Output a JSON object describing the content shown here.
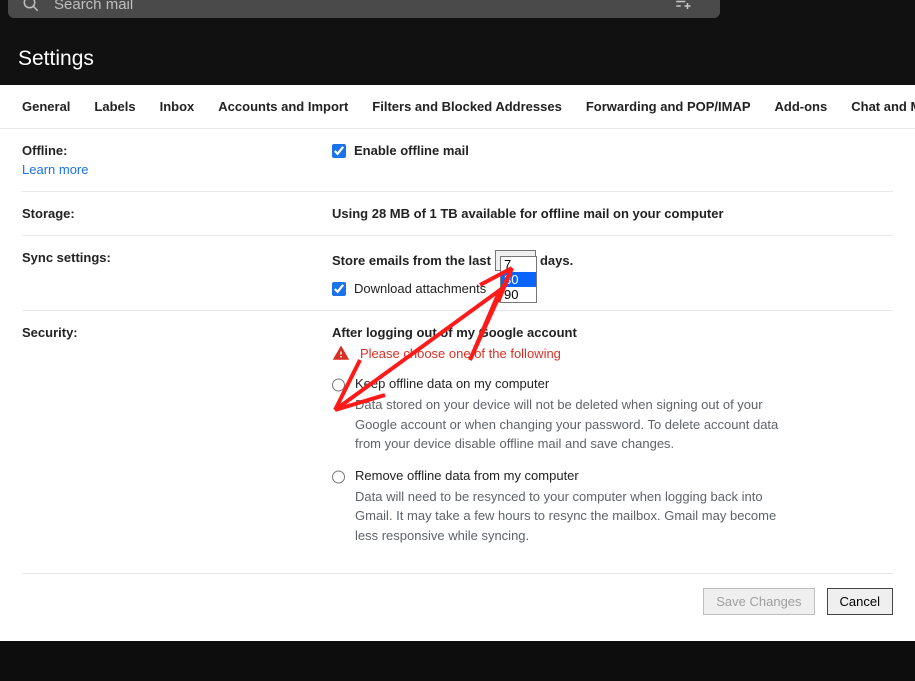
{
  "search": {
    "placeholder": "Search mail"
  },
  "page_title": "Settings",
  "tabs": [
    "General",
    "Labels",
    "Inbox",
    "Accounts and Import",
    "Filters and Blocked Addresses",
    "Forwarding and POP/IMAP",
    "Add-ons",
    "Chat and M"
  ],
  "offline": {
    "label": "Offline:",
    "learn_more": "Learn more",
    "checkbox_label": "Enable offline mail",
    "checked": true
  },
  "storage": {
    "label": "Storage:",
    "text": "Using 28 MB of 1 TB available for offline mail on your computer"
  },
  "sync": {
    "label": "Sync settings:",
    "prefix": "Store emails from the last",
    "selected": "30",
    "suffix": "days.",
    "options": [
      "7",
      "30",
      "90"
    ],
    "download_label": "Download attachments",
    "download_checked": true
  },
  "security": {
    "label": "Security:",
    "header": "After logging out of my Google account",
    "warning": "Please choose one of the following",
    "opt1_title": "Keep offline data on my computer",
    "opt1_desc": "Data stored on your device will not be deleted when signing out of your Google account or when changing your password. To delete account data from your device disable offline mail and save changes.",
    "opt2_title": "Remove offline data from my computer",
    "opt2_desc": "Data will need to be resynced to your computer when logging back into Gmail. It may take a few hours to resync the mailbox. Gmail may become less responsive while syncing."
  },
  "buttons": {
    "save": "Save Changes",
    "cancel": "Cancel"
  }
}
